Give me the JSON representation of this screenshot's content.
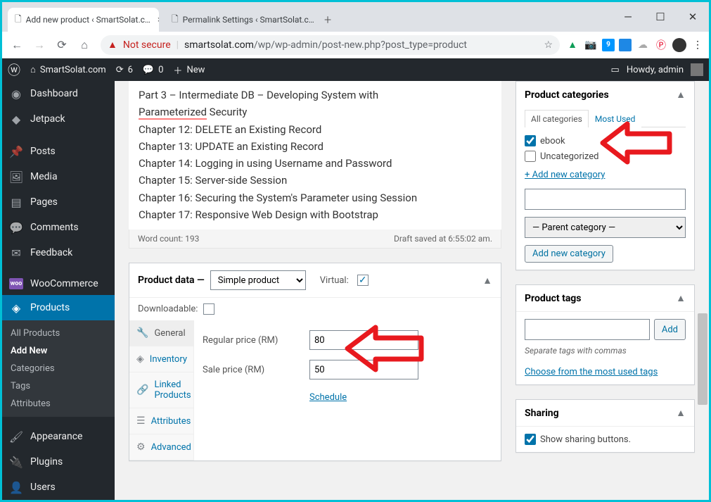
{
  "browser": {
    "tabs": [
      {
        "title": "Add new product ‹ SmartSolat.c…"
      },
      {
        "title": "Permalink Settings ‹ SmartSolat.c…"
      }
    ],
    "security_label": "Not secure",
    "url_host": "smartsolat.com",
    "url_path": "/wp/wp-admin/post-new.php?post_type=product"
  },
  "wpbar": {
    "site": "SmartSolat.com",
    "updates": "6",
    "comments": "0",
    "new": "New",
    "howdy": "Howdy, admin"
  },
  "sidebar": {
    "items": [
      {
        "icon": "dashboard",
        "label": "Dashboard"
      },
      {
        "icon": "jetpack",
        "label": "Jetpack"
      },
      {
        "icon": "pin",
        "label": "Posts"
      },
      {
        "icon": "media",
        "label": "Media"
      },
      {
        "icon": "pages",
        "label": "Pages"
      },
      {
        "icon": "comments",
        "label": "Comments"
      },
      {
        "icon": "feedback",
        "label": "Feedback"
      },
      {
        "icon": "woo",
        "label": "WooCommerce"
      },
      {
        "icon": "products",
        "label": "Products"
      },
      {
        "icon": "brush",
        "label": "Appearance"
      },
      {
        "icon": "plug",
        "label": "Plugins"
      },
      {
        "icon": "user",
        "label": "Users"
      }
    ],
    "products_sub": [
      "All Products",
      "Add New",
      "Categories",
      "Tags",
      "Attributes"
    ]
  },
  "editor": {
    "lines": [
      "Part 3 – Intermediate DB – Developing System with",
      "Parameterized Security",
      "Chapter 12: DELETE an Existing Record",
      "Chapter 13: UPDATE an Existing Record",
      "Chapter 14: Logging in using Username and Password",
      "Chapter 15: Server-side Session",
      "Chapter 16: Securing the System's Parameter using Session",
      "Chapter 17: Responsive Web Design with Bootstrap"
    ],
    "wordcount_label": "Word count: 193",
    "draft_label": "Draft saved at 6:55:02 am."
  },
  "product_data": {
    "title": "Product data",
    "type_selected": "Simple product",
    "virtual_label": "Virtual:",
    "virtual_checked": true,
    "downloadable_label": "Downloadable:",
    "downloadable_checked": false,
    "tabs": [
      "General",
      "Inventory",
      "Linked Products",
      "Attributes",
      "Advanced"
    ],
    "regular_label": "Regular price (RM)",
    "regular_value": "80",
    "sale_label": "Sale price (RM)",
    "sale_value": "50",
    "schedule": "Schedule"
  },
  "categories": {
    "title": "Product categories",
    "tab_all": "All categories",
    "tab_used": "Most Used",
    "items": [
      {
        "label": "ebook",
        "checked": true
      },
      {
        "label": "Uncategorized",
        "checked": false
      }
    ],
    "add_new_link": "+ Add new category",
    "parent_placeholder": "— Parent category —",
    "add_btn": "Add new category"
  },
  "tags": {
    "title": "Product tags",
    "add_btn": "Add",
    "separate": "Separate tags with commas",
    "choose": "Choose from the most used tags"
  },
  "sharing": {
    "title": "Sharing",
    "show_label": "Show sharing buttons."
  }
}
